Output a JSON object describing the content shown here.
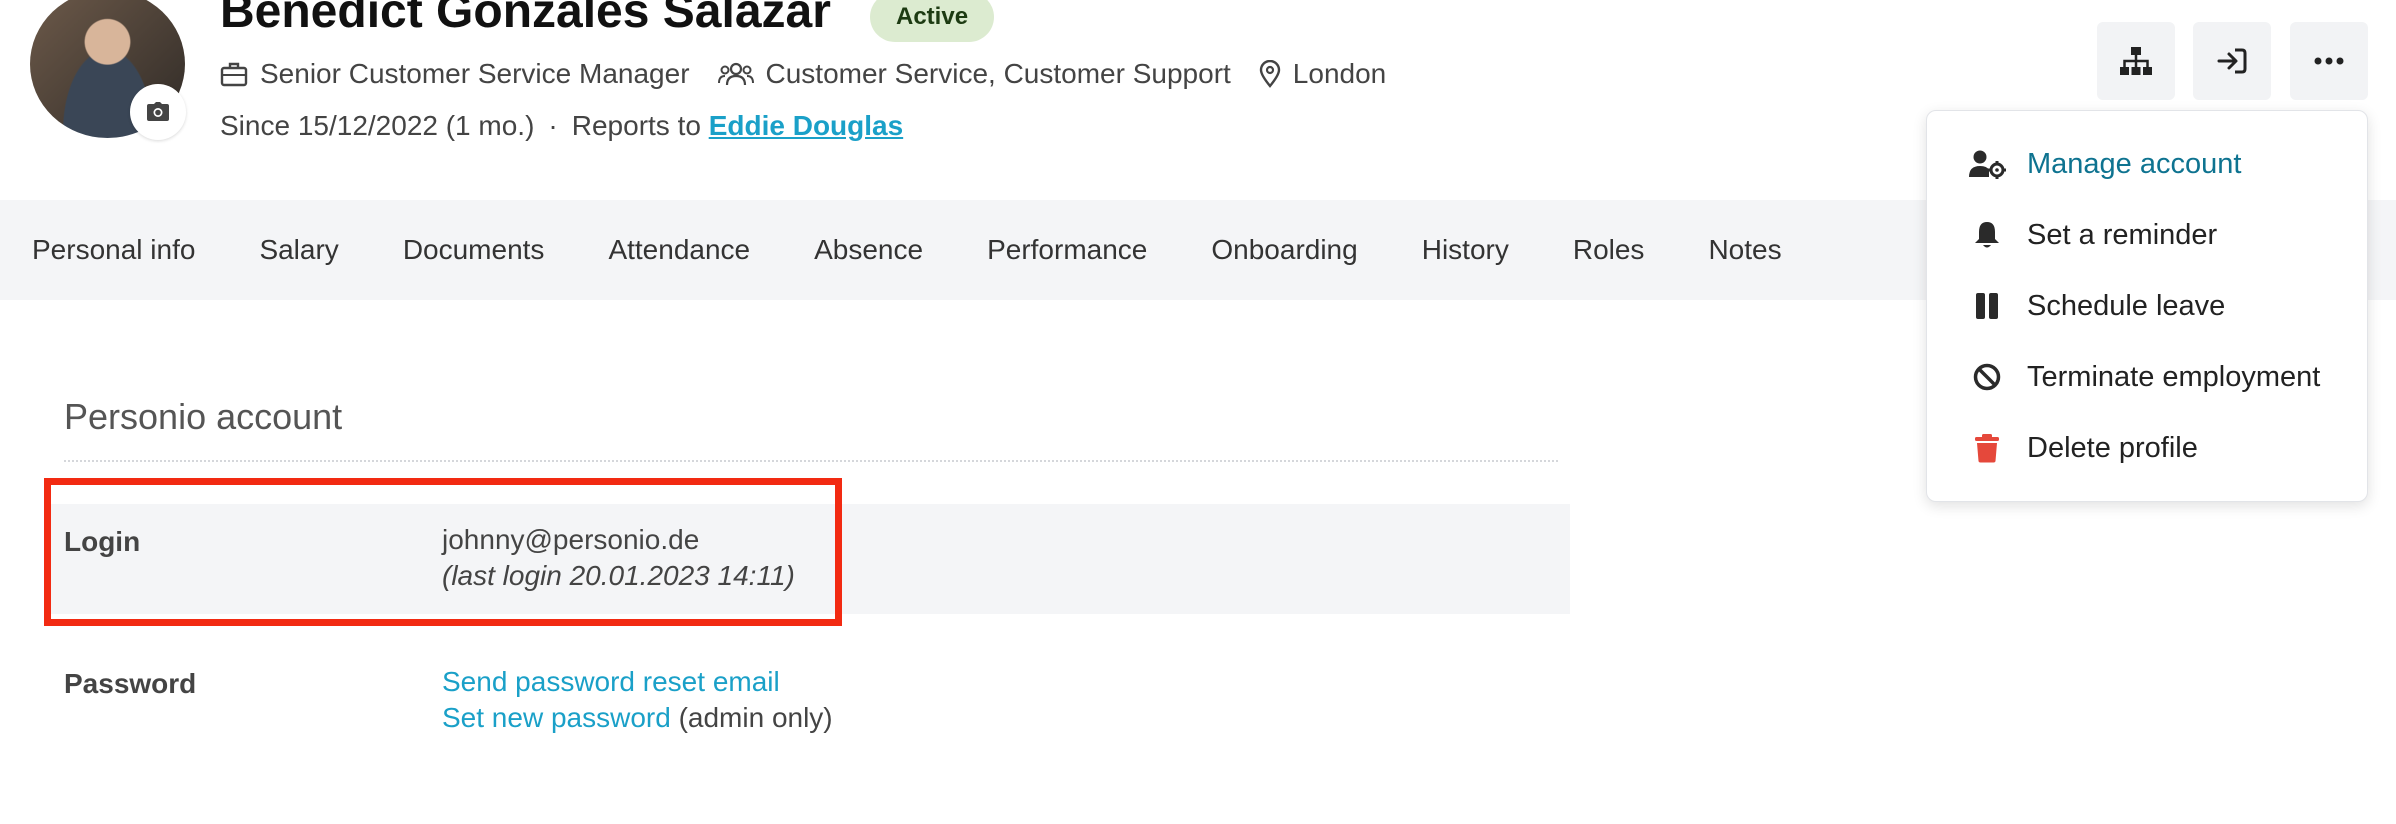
{
  "profile": {
    "name": "Benedict Gonzales Salazar",
    "status": "Active",
    "job_title": "Senior Customer Service Manager",
    "departments": "Customer Service, Customer Support",
    "location": "London",
    "since": "Since 15/12/2022 (1 mo.)",
    "separator": "·",
    "reports_to_label": "Reports to",
    "manager": "Eddie Douglas"
  },
  "tabs": [
    "Personal info",
    "Salary",
    "Documents",
    "Attendance",
    "Absence",
    "Performance",
    "Onboarding",
    "History",
    "Roles",
    "Notes"
  ],
  "section": {
    "title": "Personio account",
    "login_label": "Login",
    "login_email": "johnny@personio.de",
    "login_last": "(last login 20.01.2023 14:11)",
    "password_label": "Password",
    "send_reset": "Send password reset email",
    "set_new": "Set new password",
    "admin_only": "(admin only)"
  },
  "header_buttons": [
    "org-chart-icon",
    "login-icon",
    "more-icon"
  ],
  "dropdown": {
    "items": [
      {
        "label": "Manage account",
        "icon": "user-gear-icon"
      },
      {
        "label": "Set a reminder",
        "icon": "bell-icon"
      },
      {
        "label": "Schedule leave",
        "icon": "pause-icon"
      },
      {
        "label": "Terminate employment",
        "icon": "ban-icon"
      },
      {
        "label": "Delete profile",
        "icon": "trash-icon"
      }
    ]
  },
  "colors": {
    "accent": "#1aa0c8",
    "highlight": "#f22a12",
    "status_bg": "#dcebd0",
    "delete": "#e5483b"
  }
}
